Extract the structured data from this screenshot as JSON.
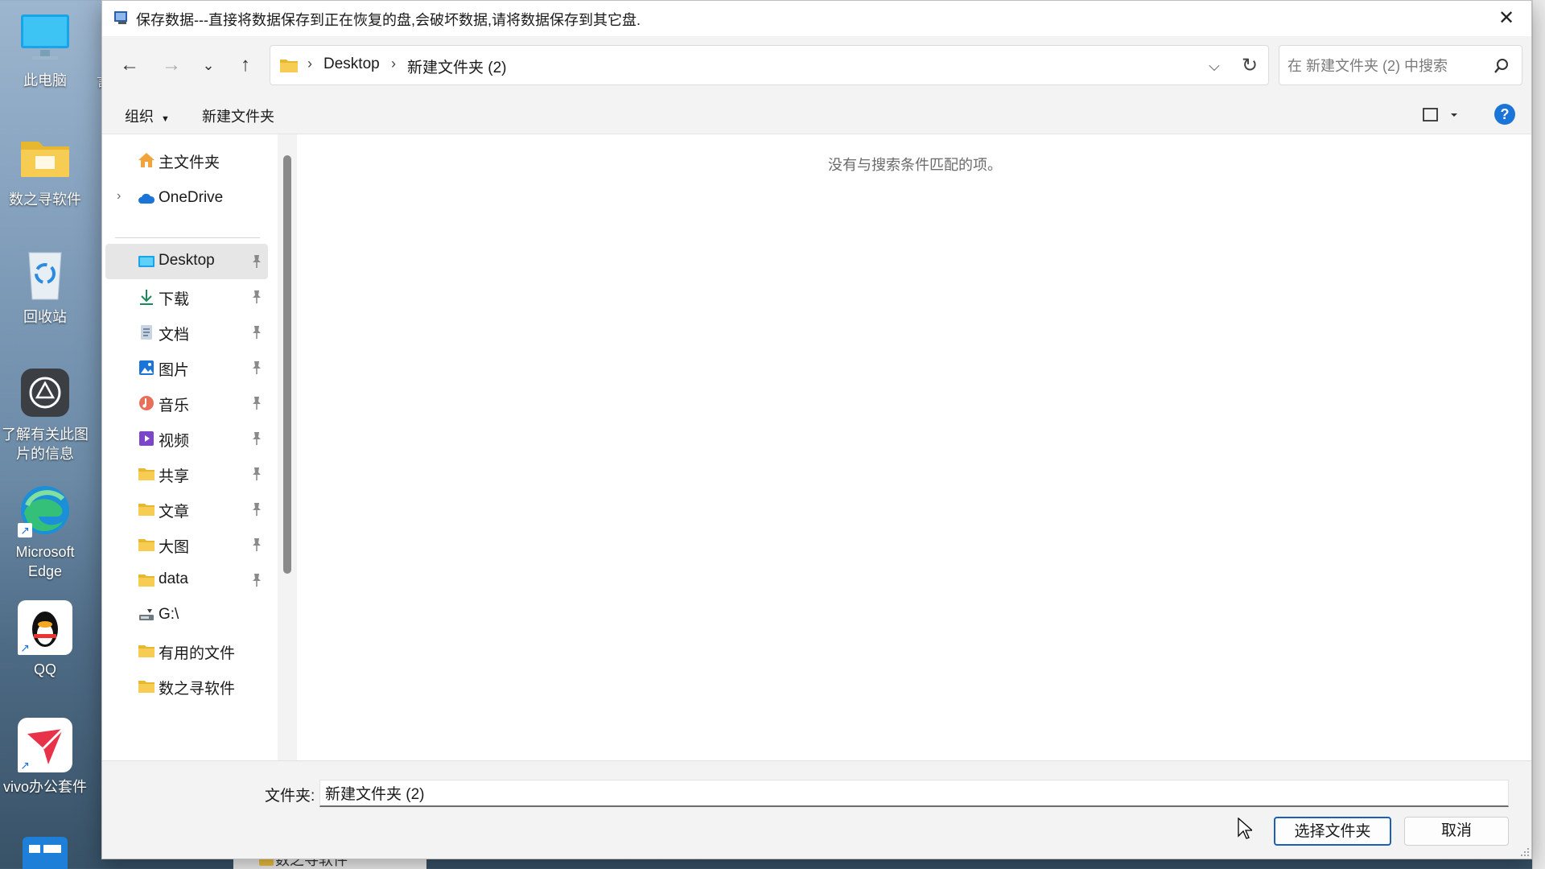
{
  "desktop": {
    "icons": [
      {
        "label": "此电脑"
      },
      {
        "label": "数之寻软件"
      },
      {
        "label": "回收站"
      },
      {
        "label": "了解有关此图片的信息"
      },
      {
        "label": "Microsoft Edge"
      },
      {
        "label": "QQ"
      },
      {
        "label": "vivo办公套件"
      }
    ],
    "peek_char": "言",
    "behind_window_item": "数之寻软件"
  },
  "dialog": {
    "title": "保存数据---直接将数据保存到正在恢复的盘,会破坏数据,请将数据保存到其它盘.",
    "close_icon": "close-icon",
    "nav": {
      "back_icon": "arrow-left-icon",
      "forward_icon": "arrow-right-icon",
      "recent_icon": "chevron-down-icon",
      "up_icon": "arrow-up-icon"
    },
    "address": {
      "crumbs": [
        "Desktop",
        "新建文件夹 (2)"
      ]
    },
    "search": {
      "placeholder": "在 新建文件夹 (2) 中搜索"
    },
    "commands": {
      "organize": "组织",
      "new_folder": "新建文件夹",
      "help": "?"
    },
    "sidebar": {
      "top": [
        {
          "label": "主文件夹",
          "icon": "home-icon"
        },
        {
          "label": "OneDrive",
          "icon": "cloud-icon"
        }
      ],
      "quick": [
        {
          "label": "Desktop",
          "icon": "desktop-icon",
          "pinned": true,
          "selected": true
        },
        {
          "label": "下载",
          "icon": "download-icon",
          "pinned": true
        },
        {
          "label": "文档",
          "icon": "document-icon",
          "pinned": true
        },
        {
          "label": "图片",
          "icon": "picture-icon",
          "pinned": true
        },
        {
          "label": "音乐",
          "icon": "music-icon",
          "pinned": true
        },
        {
          "label": "视频",
          "icon": "video-icon",
          "pinned": true
        },
        {
          "label": "共享",
          "icon": "folder-icon",
          "pinned": true
        },
        {
          "label": "文章",
          "icon": "folder-icon",
          "pinned": true
        },
        {
          "label": "大图",
          "icon": "folder-icon",
          "pinned": true
        },
        {
          "label": "data",
          "icon": "folder-icon",
          "pinned": true
        },
        {
          "label": "G:\\",
          "icon": "drive-icon",
          "pinned": false
        },
        {
          "label": "有用的文件",
          "icon": "folder-icon",
          "pinned": false
        },
        {
          "label": "数之寻软件",
          "icon": "folder-icon",
          "pinned": false
        }
      ]
    },
    "content": {
      "empty_message": "没有与搜索条件匹配的项。"
    },
    "footer": {
      "folder_label": "文件夹:",
      "folder_value": "新建文件夹 (2)",
      "select_button": "选择文件夹",
      "cancel_button": "取消"
    }
  },
  "colors": {
    "accent": "#1b74d8",
    "folder": "#f4c542",
    "chrome": "#f3f3f3"
  }
}
